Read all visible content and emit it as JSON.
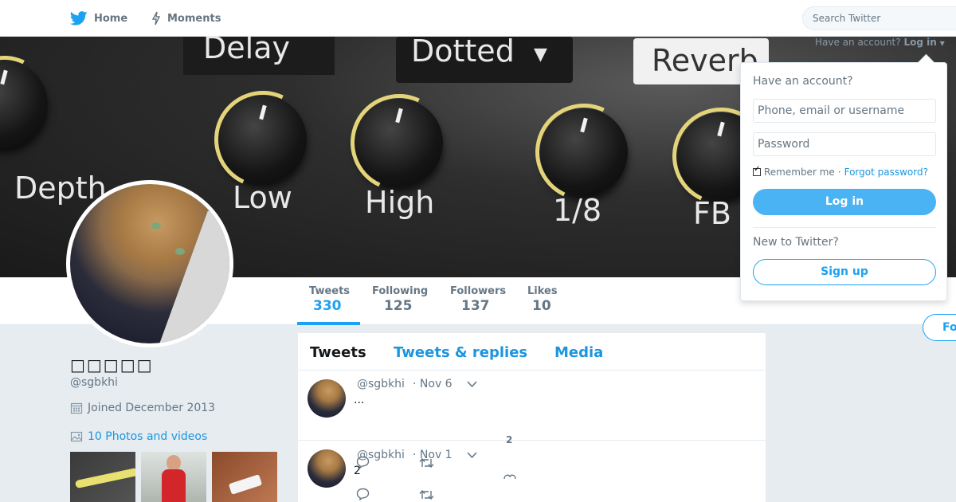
{
  "nav": {
    "home_label": "Home",
    "moments_label": "Moments",
    "search_placeholder": "Search Twitter",
    "have_account": "Have an account?",
    "login_menu": "Log in"
  },
  "header_photo": {
    "labels": [
      "Delay",
      "Dotted",
      "Reverb",
      "Depth",
      "Low",
      "High",
      "1/8",
      "FB"
    ]
  },
  "profile": {
    "name": "□□□□□",
    "handle": "@sgbkhi",
    "joined": "Joined December 2013",
    "photos": "10 Photos and videos"
  },
  "stats": [
    {
      "label": "Tweets",
      "value": "330"
    },
    {
      "label": "Following",
      "value": "125"
    },
    {
      "label": "Followers",
      "value": "137"
    },
    {
      "label": "Likes",
      "value": "10"
    }
  ],
  "follow_label": "Fo",
  "timeline": {
    "tabs": [
      "Tweets",
      "Tweets & replies",
      "Media"
    ],
    "tweets": [
      {
        "handle": "@sgbkhi",
        "time": "· Nov 6",
        "text": "...",
        "like_count": "2"
      },
      {
        "handle": "@sgbkhi",
        "time": "· Nov 1",
        "text": "2",
        "like_count": ""
      }
    ]
  },
  "login_box": {
    "title": "Have an account?",
    "username_placeholder": "Phone, email or username",
    "password_placeholder": "Password",
    "remember": "Remember me",
    "separator": "·",
    "forgot": "Forgot password?",
    "login_button": "Log in",
    "new_to": "New to Twitter?",
    "signup_button": "Sign up"
  },
  "colors": {
    "accent": "#1da1f2",
    "login_button": "#4ab3f4",
    "muted": "#657786",
    "background": "#e6ecf0"
  }
}
